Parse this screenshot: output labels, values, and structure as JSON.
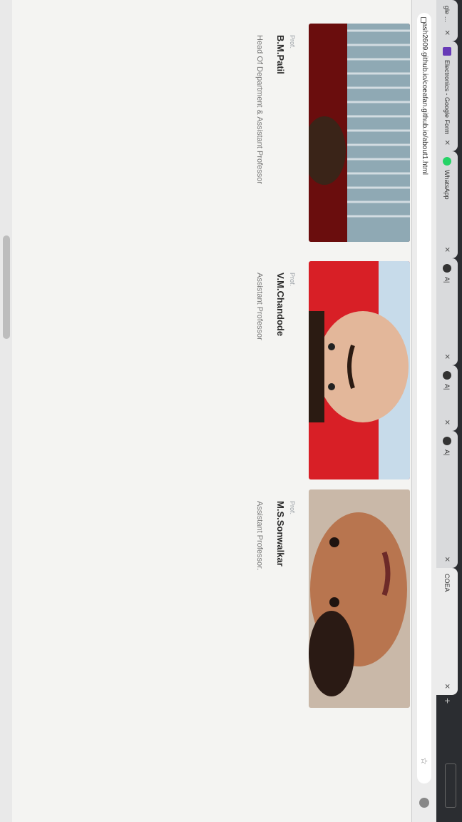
{
  "browser": {
    "tabs": [
      {
        "title": "gle Drive",
        "icon": "drive-icon"
      },
      {
        "title": "Electronics - Google Form",
        "icon": "google-forms-icon"
      },
      {
        "title": "WhatsApp",
        "icon": "whatsapp-icon"
      },
      {
        "title": "A|",
        "icon": "github-icon"
      },
      {
        "title": "A|",
        "icon": "github-icon"
      },
      {
        "title": "A|",
        "icon": "github-icon"
      },
      {
        "title": "COEA",
        "icon": "page-icon"
      }
    ],
    "new_tab": "+",
    "url": "ash2609.github.io/coeafan.github.io/about1.html"
  },
  "faculty": [
    {
      "prefix": "Prof.",
      "name": "B.M.Patil",
      "role": "Head Of Department & Assistant Professor"
    },
    {
      "prefix": "Prof.",
      "name": "V.M.Chandode",
      "role": "Assistant Professor"
    },
    {
      "prefix": "Prof.",
      "name": "M.S.Sonwalkar",
      "role": "Assistant Professor."
    }
  ],
  "colors": {
    "photo_bg_1": "#6a0d0d",
    "photo_bg_2": "#d81f26",
    "photo_bg_3": "#c9b8a8"
  }
}
